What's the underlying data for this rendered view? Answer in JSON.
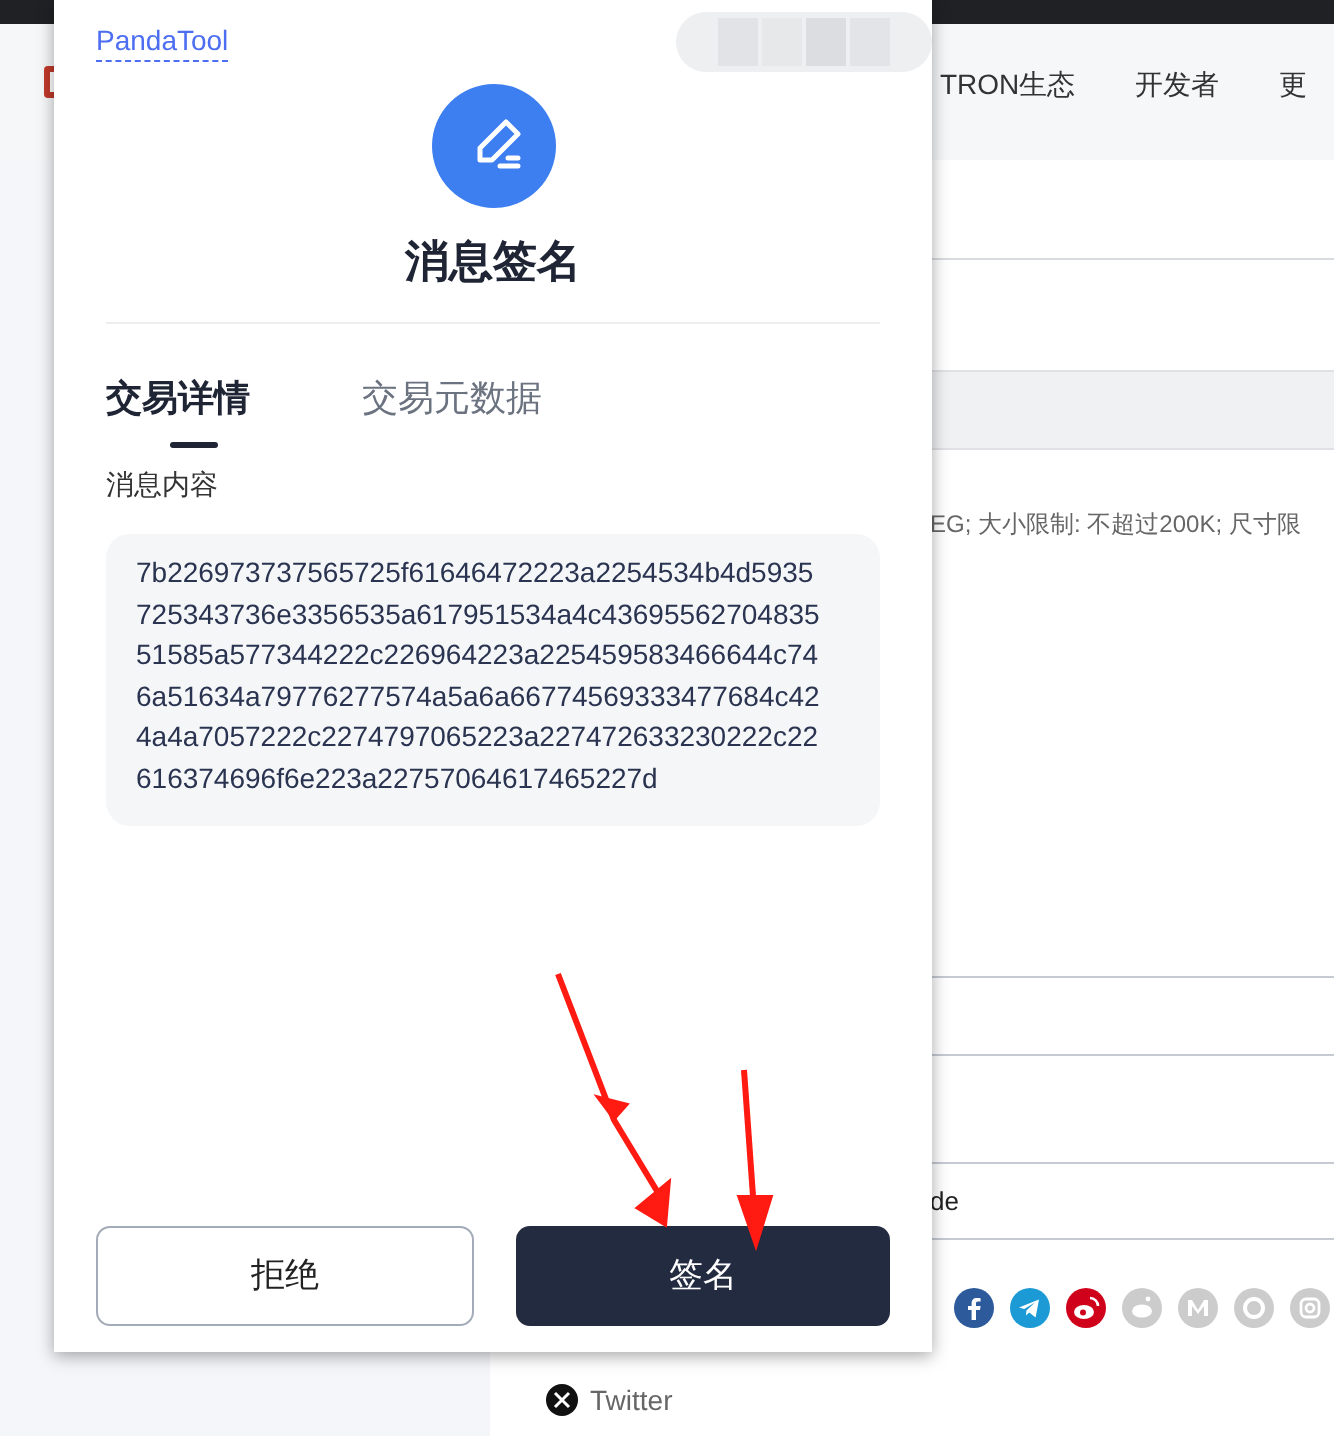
{
  "nav": {
    "items": [
      "TRON生态",
      "开发者",
      "更"
    ]
  },
  "page": {
    "hint": "EG; 大小限制: 不超过200K; 尺寸限",
    "row_text": "de",
    "social_link": "Twitter"
  },
  "popup": {
    "brand": "PandaTool",
    "title": "消息签名",
    "tabs": [
      {
        "label": "交易详情",
        "selected": true
      },
      {
        "label": "交易元数据",
        "selected": false
      }
    ],
    "field_label": "消息内容",
    "message_lines": [
      "7b226973737565725f61646472223a2254534b4d5935",
      "725343736e3356535a617951534a4c43695562704835",
      "51585a577344222c226964223a225459583466644c74",
      "6a51634a79776277574a5a6a66774569333477684c42",
      "4a4a7057222c2274797065223a227472633230222c22",
      "616374696f6e223a22757064617465227d"
    ],
    "buttons": [
      {
        "label": "拒绝",
        "kind": "secondary"
      },
      {
        "label": "签名",
        "kind": "primary"
      }
    ]
  }
}
